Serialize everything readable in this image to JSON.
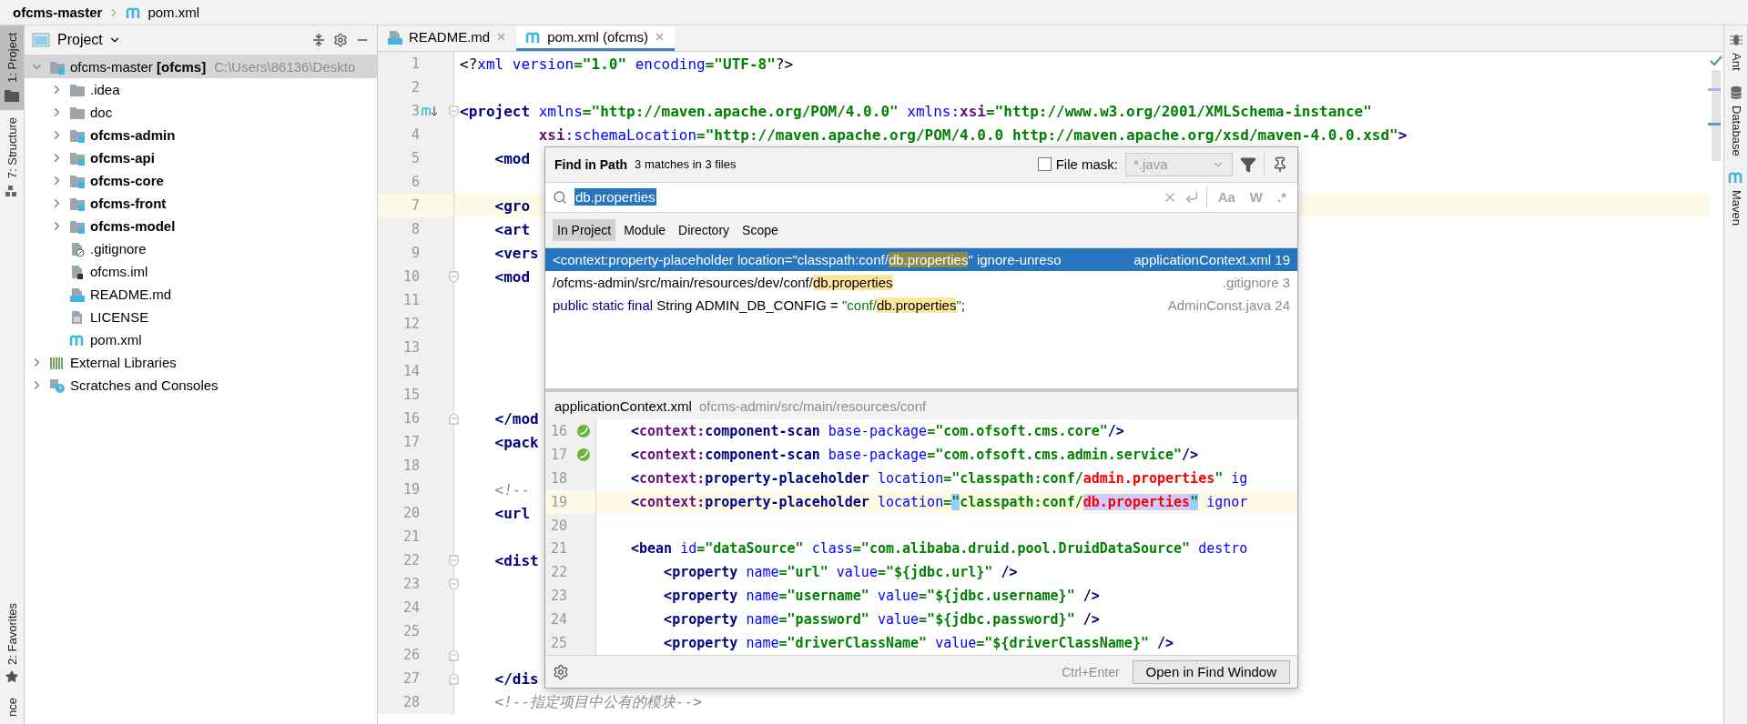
{
  "breadcrumb": {
    "project": "ofcms-master",
    "file": "pom.xml"
  },
  "left_strip": {
    "top": [
      {
        "label": "1: Project",
        "kind": "project",
        "selected": true
      },
      {
        "label": "7: Structure",
        "kind": "structure",
        "selected": false
      }
    ],
    "bottom": [
      {
        "label": "2: Favorites",
        "kind": "favorites",
        "selected": false
      },
      {
        "label": "nce",
        "kind": "plain",
        "selected": false
      }
    ]
  },
  "project_panel": {
    "title": "Project",
    "tree": [
      {
        "label": "ofcms-master **[ofcms]**",
        "hint": "C:\\Users\\86136\\Deskto",
        "kind": "project",
        "expanded": true,
        "selected": true,
        "children": [
          {
            "label": ".idea",
            "kind": "folder",
            "expanded": false,
            "selected": false
          },
          {
            "label": "doc",
            "kind": "folder",
            "expanded": false,
            "selected": false
          },
          {
            "label": "ofcms-admin",
            "kind": "module",
            "expanded": false,
            "selected": false
          },
          {
            "label": "ofcms-api",
            "kind": "module",
            "expanded": false,
            "selected": false
          },
          {
            "label": "ofcms-core",
            "kind": "module",
            "expanded": false,
            "selected": false
          },
          {
            "label": "ofcms-front",
            "kind": "module",
            "expanded": false,
            "selected": false
          },
          {
            "label": "ofcms-model",
            "kind": "module",
            "expanded": false,
            "selected": false
          },
          {
            "label": ".gitignore",
            "kind": "ignore",
            "selected": false
          },
          {
            "label": "ofcms.iml",
            "kind": "iml",
            "selected": false
          },
          {
            "label": "README.md",
            "kind": "markdown",
            "selected": false
          },
          {
            "label": "LICENSE",
            "kind": "text",
            "selected": false
          },
          {
            "label": "pom.xml",
            "kind": "maven",
            "selected": false
          }
        ]
      },
      {
        "label": "External Libraries",
        "kind": "libraries",
        "expanded": false,
        "selected": false
      },
      {
        "label": "Scratches and Consoles",
        "kind": "scratches",
        "expanded": false,
        "selected": false
      }
    ]
  },
  "tabs": [
    {
      "label": "README.md",
      "kind": "markdown",
      "selected": false
    },
    {
      "label": "pom.xml (ofcms)",
      "kind": "maven",
      "selected": true
    }
  ],
  "editor": {
    "lines": [
      {
        "number": "1",
        "current": false,
        "tokens": [
          {
            "text": "<?",
            "kind": "plain"
          },
          {
            "text": "xml version",
            "kind": "attr"
          },
          {
            "text": "=\"1.0\"",
            "kind": "val"
          },
          {
            "text": " encoding",
            "kind": "attr"
          },
          {
            "text": "=\"UTF-8\"",
            "kind": "val"
          },
          {
            "text": "?>",
            "kind": "plain"
          }
        ]
      },
      {
        "number": "2",
        "current": false
      },
      {
        "number": "3",
        "current": false,
        "markers": [
          {
            "kind": "override"
          },
          {
            "kind": "fold_start"
          }
        ],
        "tokens": [
          {
            "text": "<project",
            "kind": "tag"
          },
          {
            "text": " xmlns",
            "kind": "attr"
          },
          {
            "text": "=\"http://maven.apache.org/POM/4.0.0\"",
            "kind": "val"
          },
          {
            "text": " xmlns:",
            "kind": "attr"
          },
          {
            "text": "xsi",
            "kind": "ns"
          },
          {
            "text": "=\"http://www.w3.org/2001/XMLSchema-instance\"",
            "kind": "val"
          }
        ]
      },
      {
        "number": "4",
        "current": false,
        "tokens": [
          {
            "text": "         xsi",
            "kind": "ns"
          },
          {
            "text": ":schemaLocation",
            "kind": "attr"
          },
          {
            "text": "=\"http://maven.apache.org/POM/4.0.0 http://maven.apache.org/xsd/maven-4.0.0.xsd\"",
            "kind": "val"
          },
          {
            "text": ">",
            "kind": "tag"
          }
        ]
      },
      {
        "number": "5",
        "current": false,
        "tokens": [
          {
            "text": "    <mod",
            "kind": "tag"
          }
        ]
      },
      {
        "number": "6",
        "current": false
      },
      {
        "number": "7",
        "current": true,
        "tokens": [
          {
            "text": "    <gro",
            "kind": "tag"
          }
        ]
      },
      {
        "number": "8",
        "current": false,
        "tokens": [
          {
            "text": "    <art",
            "kind": "tag"
          }
        ]
      },
      {
        "number": "9",
        "current": false,
        "tokens": [
          {
            "text": "    <vers",
            "kind": "tag"
          }
        ]
      },
      {
        "number": "10",
        "current": false,
        "markers": [
          {
            "kind": "fold_start"
          }
        ],
        "tokens": [
          {
            "text": "    <mod",
            "kind": "tag"
          }
        ]
      },
      {
        "number": "11",
        "current": false
      },
      {
        "number": "12",
        "current": false
      },
      {
        "number": "13",
        "current": false
      },
      {
        "number": "14",
        "current": false
      },
      {
        "number": "15",
        "current": false
      },
      {
        "number": "16",
        "current": false,
        "markers": [
          {
            "kind": "fold_end"
          }
        ],
        "tokens": [
          {
            "text": "    </mod",
            "kind": "tag"
          }
        ]
      },
      {
        "number": "17",
        "current": false,
        "tokens": [
          {
            "text": "    <pack",
            "kind": "tag"
          }
        ]
      },
      {
        "number": "18",
        "current": false
      },
      {
        "number": "19",
        "current": false,
        "tokens": [
          {
            "text": "    <!--",
            "kind": "comment"
          }
        ]
      },
      {
        "number": "20",
        "current": false,
        "tokens": [
          {
            "text": "    <url",
            "kind": "tag"
          }
        ]
      },
      {
        "number": "21",
        "current": false
      },
      {
        "number": "22",
        "current": false,
        "markers": [
          {
            "kind": "fold_start"
          }
        ],
        "tokens": [
          {
            "text": "    <dist",
            "kind": "tag"
          }
        ]
      },
      {
        "number": "23",
        "current": false,
        "markers": [
          {
            "kind": "fold_start"
          }
        ]
      },
      {
        "number": "24",
        "current": false
      },
      {
        "number": "25",
        "current": false
      },
      {
        "number": "26",
        "current": false,
        "markers": [
          {
            "kind": "fold_end"
          }
        ]
      },
      {
        "number": "27",
        "current": false,
        "markers": [
          {
            "kind": "fold_end"
          }
        ],
        "tokens": [
          {
            "text": "    </dis",
            "kind": "tag"
          }
        ]
      },
      {
        "number": "28",
        "current": false,
        "tokens": [
          {
            "text": "    <!--指定项目中公有的模块-->",
            "kind": "comment"
          }
        ]
      }
    ]
  },
  "find_popup": {
    "title": "Find in Path",
    "summary": "3 matches in 3 files",
    "file_mask": {
      "label": "File mask:",
      "checked": false,
      "value": "*.java"
    },
    "query": "db.properties",
    "options": [
      "Aa",
      "W",
      ".*"
    ],
    "scopes": [
      {
        "label": "In Project",
        "selected": true
      },
      {
        "label": "Module",
        "selected": false
      },
      {
        "label": "Directory",
        "selected": false
      },
      {
        "label": "Scope",
        "selected": false
      }
    ],
    "results": [
      {
        "selected": true,
        "segments": [
          {
            "text": "<context:property-placeholder location=\"classpath:conf/",
            "kind": "plain"
          },
          {
            "text": "db.properties",
            "kind": "match"
          },
          {
            "text": "\" ignore-unreso",
            "kind": "plain"
          }
        ],
        "location": "applicationContext.xml 19"
      },
      {
        "selected": false,
        "segments": [
          {
            "text": "/ofcms-admin/src/main/resources/dev/conf/",
            "kind": "plain"
          },
          {
            "text": "db.properties",
            "kind": "match"
          }
        ],
        "location": ".gitignore 3"
      },
      {
        "selected": false,
        "segments": [
          {
            "text": "public static final",
            "kind": "keyword"
          },
          {
            "text": " String ADMIN_DB_CONFIG = ",
            "kind": "plain"
          },
          {
            "text": "\"conf/",
            "kind": "string"
          },
          {
            "text": "db.properties",
            "kind": "match"
          },
          {
            "text": "\"",
            "kind": "string"
          },
          {
            "text": ";",
            "kind": "plain"
          }
        ],
        "location": "AdminConst.java 24"
      }
    ],
    "preview": {
      "file": "applicationContext.xml",
      "path": "ofcms-admin/src/main/resources/conf",
      "lines": [
        {
          "number": "16",
          "current": false,
          "markers": [
            {
              "kind": "bean"
            }
          ],
          "tokens": [
            {
              "text": "<",
              "kind": "tag"
            },
            {
              "text": "context:",
              "kind": "ns"
            },
            {
              "text": "component-scan",
              "kind": "tag"
            },
            {
              "text": " base-package",
              "kind": "attr"
            },
            {
              "text": "=\"com.ofsoft.cms.core\"",
              "kind": "val"
            },
            {
              "text": "/>",
              "kind": "tag"
            }
          ]
        },
        {
          "number": "17",
          "current": false,
          "markers": [
            {
              "kind": "bean"
            }
          ],
          "tokens": [
            {
              "text": "<",
              "kind": "tag"
            },
            {
              "text": "context:",
              "kind": "ns"
            },
            {
              "text": "component-scan",
              "kind": "tag"
            },
            {
              "text": " base-package",
              "kind": "attr"
            },
            {
              "text": "=\"com.ofsoft.cms.admin.service\"",
              "kind": "val"
            },
            {
              "text": "/>",
              "kind": "tag"
            }
          ]
        },
        {
          "number": "18",
          "current": false,
          "tokens": [
            {
              "text": "<",
              "kind": "tag"
            },
            {
              "text": "context:",
              "kind": "ns"
            },
            {
              "text": "property-placeholder",
              "kind": "tag"
            },
            {
              "text": " location",
              "kind": "attr"
            },
            {
              "text": "=\"classpath:conf/",
              "kind": "val"
            },
            {
              "text": "admin.properties",
              "kind": "red"
            },
            {
              "text": "\"",
              "kind": "val"
            },
            {
              "text": " ig",
              "kind": "attr"
            }
          ]
        },
        {
          "number": "19",
          "current": true,
          "tokens": [
            {
              "text": "<",
              "kind": "tag"
            },
            {
              "text": "context:",
              "kind": "ns"
            },
            {
              "text": "property-placeholder",
              "kind": "tag"
            },
            {
              "text": " location",
              "kind": "attr"
            },
            {
              "text": "=",
              "kind": "val"
            },
            {
              "text": "\"",
              "kind": "brace"
            },
            {
              "text": "classpath:conf/",
              "kind": "val"
            },
            {
              "text": "db.properties",
              "kind": "found"
            },
            {
              "text": "\"",
              "kind": "brace"
            },
            {
              "text": " ignor",
              "kind": "attr"
            }
          ]
        },
        {
          "number": "20",
          "current": false
        },
        {
          "number": "21",
          "current": false,
          "tokens": [
            {
              "text": "<bean",
              "kind": "tag"
            },
            {
              "text": " id",
              "kind": "attr"
            },
            {
              "text": "=\"dataSource\"",
              "kind": "val"
            },
            {
              "text": " class",
              "kind": "attr"
            },
            {
              "text": "=\"com.alibaba.druid.pool.DruidDataSource\"",
              "kind": "val"
            },
            {
              "text": " destro",
              "kind": "attr"
            }
          ]
        },
        {
          "number": "22",
          "current": false,
          "tokens": [
            {
              "text": "    <property",
              "kind": "tag"
            },
            {
              "text": " name",
              "kind": "attr"
            },
            {
              "text": "=\"url\"",
              "kind": "val"
            },
            {
              "text": " value",
              "kind": "attr"
            },
            {
              "text": "=\"${jdbc.url}\"",
              "kind": "val"
            },
            {
              "text": " />",
              "kind": "tag"
            }
          ]
        },
        {
          "number": "23",
          "current": false,
          "tokens": [
            {
              "text": "    <property",
              "kind": "tag"
            },
            {
              "text": " name",
              "kind": "attr"
            },
            {
              "text": "=\"username\"",
              "kind": "val"
            },
            {
              "text": " value",
              "kind": "attr"
            },
            {
              "text": "=\"${jdbc.username}\"",
              "kind": "val"
            },
            {
              "text": " />",
              "kind": "tag"
            }
          ]
        },
        {
          "number": "24",
          "current": false,
          "tokens": [
            {
              "text": "    <property",
              "kind": "tag"
            },
            {
              "text": " name",
              "kind": "attr"
            },
            {
              "text": "=\"password\"",
              "kind": "val"
            },
            {
              "text": " value",
              "kind": "attr"
            },
            {
              "text": "=\"${jdbc.password}\"",
              "kind": "val"
            },
            {
              "text": " />",
              "kind": "tag"
            }
          ]
        },
        {
          "number": "25",
          "current": false,
          "tokens": [
            {
              "text": "    <property",
              "kind": "tag"
            },
            {
              "text": " name",
              "kind": "attr"
            },
            {
              "text": "=\"driverClassName\"",
              "kind": "val"
            },
            {
              "text": " value",
              "kind": "attr"
            },
            {
              "text": "=\"${driverClassName}\"",
              "kind": "val"
            },
            {
              "text": " />",
              "kind": "tag"
            }
          ]
        }
      ]
    },
    "shortcut": "Ctrl+Enter",
    "open_button": "Open in Find Window"
  },
  "right_strip": [
    {
      "label": "Ant",
      "kind": "ant"
    },
    {
      "label": "Database",
      "kind": "database"
    },
    {
      "label": "Maven",
      "kind": "maven"
    }
  ]
}
